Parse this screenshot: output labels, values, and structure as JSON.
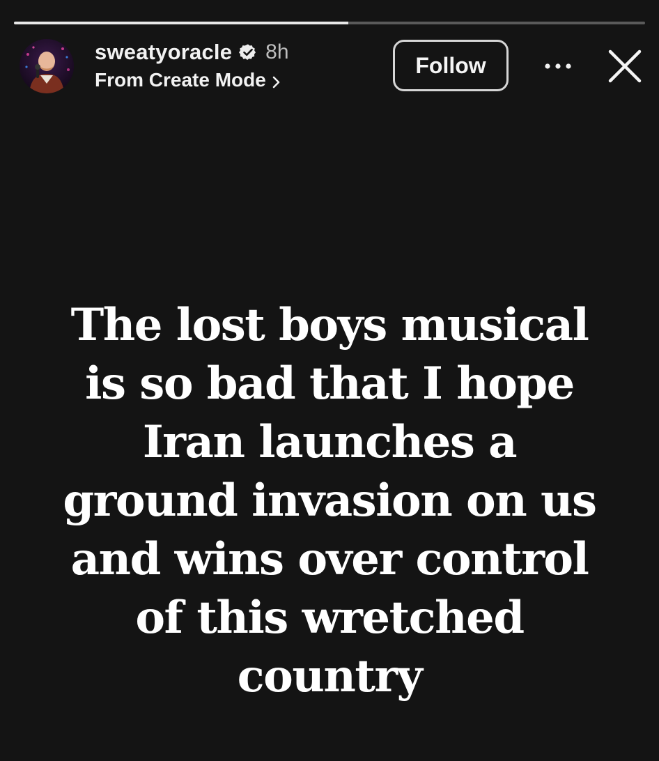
{
  "story": {
    "progress": {
      "total_segments": 1,
      "completed_fraction": 0.53
    },
    "header": {
      "username": "sweatyoracle",
      "verified": true,
      "time_ago": "8h",
      "subtitle": "From Create Mode",
      "follow_label": "Follow",
      "icons": {
        "verified": "verified-badge-icon",
        "subtitle_arrow": "chevron-right-icon",
        "more": "more-options-icon",
        "close": "close-icon"
      }
    },
    "text": "The lost boys musical\nis so bad that I hope\nIran launches a\nground invasion on us\nand wins over control\nof this wretched\ncountry"
  },
  "colors": {
    "background": "#141414",
    "text": "#ffffff",
    "progress_done": "#e8e8e8",
    "progress_remaining": "#5a5a5a"
  }
}
